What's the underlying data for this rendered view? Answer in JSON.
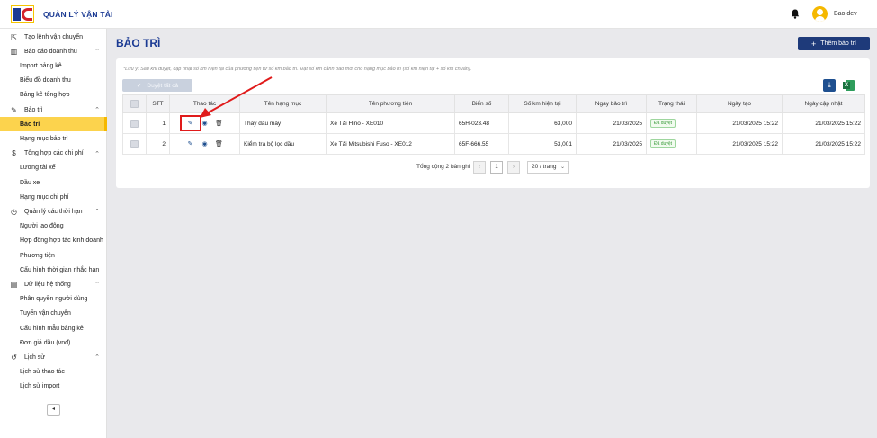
{
  "header": {
    "app_title": "QUẢN LÝ VẬN TẢI",
    "user_name": "Bao dev",
    "icons": {
      "logo": "logo-icon",
      "bell": "bell-icon",
      "avatar": "user-avatar"
    }
  },
  "sidebar": {
    "items": [
      {
        "type": "group",
        "label": "Tạo lệnh vận chuyển",
        "icon": "truck-icon",
        "chevron": false
      },
      {
        "type": "group",
        "label": "Báo cáo doanh thu",
        "icon": "chart-icon",
        "chevron": true
      },
      {
        "type": "sub",
        "label": "Import bảng kê"
      },
      {
        "type": "sub",
        "label": "Biểu đồ doanh thu"
      },
      {
        "type": "sub",
        "label": "Bảng kê tổng hợp"
      },
      {
        "type": "group",
        "label": "Bảo trì",
        "icon": "wrench-icon",
        "chevron": true
      },
      {
        "type": "sub",
        "label": "Bảo trì",
        "active": true
      },
      {
        "type": "sub",
        "label": "Hạng mục bảo trì"
      },
      {
        "type": "group",
        "label": "Tổng hợp các chi phí",
        "icon": "dollar-icon",
        "chevron": true
      },
      {
        "type": "sub",
        "label": "Lương tài xế"
      },
      {
        "type": "sub",
        "label": "Dầu xe"
      },
      {
        "type": "sub",
        "label": "Hạng mục chi phí"
      },
      {
        "type": "group",
        "label": "Quản lý các thời hạn",
        "icon": "clock-icon",
        "chevron": true
      },
      {
        "type": "sub",
        "label": "Người lao động"
      },
      {
        "type": "sub",
        "label": "Hợp đồng hợp tác kinh doanh"
      },
      {
        "type": "sub",
        "label": "Phương tiện"
      },
      {
        "type": "sub",
        "label": "Cấu hình thời gian nhắc hạn"
      },
      {
        "type": "group",
        "label": "Dữ liệu hệ thống",
        "icon": "database-icon",
        "chevron": true
      },
      {
        "type": "sub",
        "label": "Phân quyền người dùng"
      },
      {
        "type": "sub",
        "label": "Tuyến vận chuyển"
      },
      {
        "type": "sub",
        "label": "Cấu hình mẫu bảng kê"
      },
      {
        "type": "sub",
        "label": "Đơn giá dầu (vnđ)"
      },
      {
        "type": "group",
        "label": "Lịch sử",
        "icon": "history-icon",
        "chevron": true
      },
      {
        "type": "sub",
        "label": "Lịch sử thao tác"
      },
      {
        "type": "sub",
        "label": "Lịch sử import"
      }
    ],
    "collapse_glyph": "◂"
  },
  "main": {
    "page_title": "BẢO TRÌ",
    "add_button": "Thêm bảo trì",
    "note": "*Lưu ý: Sau khi duyệt, cập nhật số km hiện tại của phương tiện từ số km bảo trì. Đặt số km cảnh báo mới cho hạng mục bảo trì (số km hiện tại + số km chuẩn).",
    "approve_all": "Duyệt tất cả",
    "table": {
      "headers": [
        "STT",
        "Thao tác",
        "Tên hạng mục",
        "Tên phương tiện",
        "Biển số",
        "Số km hiện tại",
        "Ngày bảo trì",
        "Trạng thái",
        "Ngày tạo",
        "Ngày cập nhật"
      ],
      "rows": [
        {
          "stt": "1",
          "item": "Thay dầu máy",
          "vehicle": "Xe Tải Hino - XE010",
          "plate": "65H-023.48",
          "km": "63,000",
          "maint_date": "21/03/2025",
          "status": "Đã duyệt",
          "created": "21/03/2025 15:22",
          "updated": "21/03/2025 15:22"
        },
        {
          "stt": "2",
          "item": "Kiểm tra bộ lọc dầu",
          "vehicle": "Xe Tải Mitsubishi Fuso - XE012",
          "plate": "65F-666.55",
          "km": "53,001",
          "maint_date": "21/03/2025",
          "status": "Đã duyệt",
          "created": "21/03/2025 15:22",
          "updated": "21/03/2025 15:22"
        }
      ]
    },
    "pagination": {
      "total": "Tổng cộng 2 bản ghi",
      "current_page": "1",
      "page_size": "20 / trang"
    }
  },
  "colors": {
    "primary": "#1b3a93",
    "active": "#fcd34d",
    "highlight": "#e01b1b",
    "status_ok": "#3b9b3b"
  }
}
